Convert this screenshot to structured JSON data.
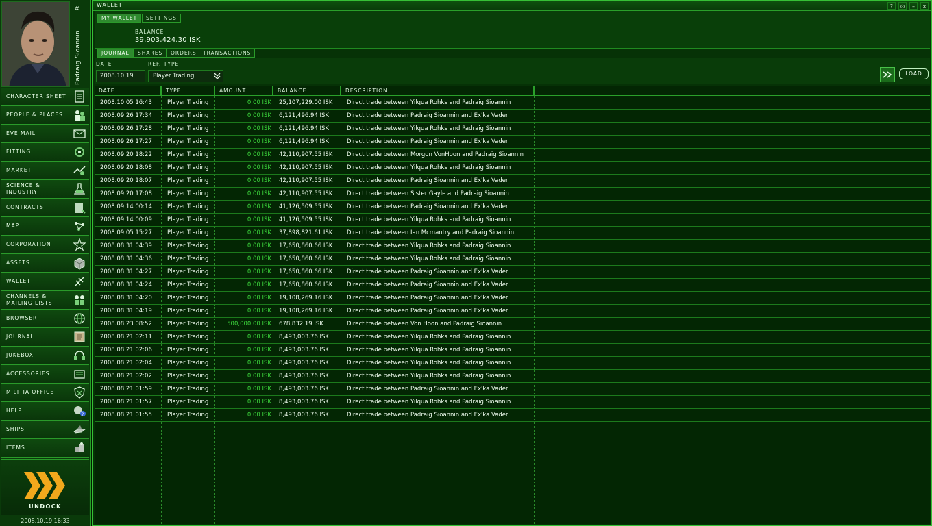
{
  "sidebar": {
    "character_name": "Padraig Sioannin",
    "collapse_glyph": "«",
    "items": [
      {
        "label": "CHARACTER SHEET",
        "icon": "character-sheet-icon"
      },
      {
        "label": "PEOPLE & PLACES",
        "icon": "people-places-icon"
      },
      {
        "label": "EVE MAIL",
        "icon": "mail-icon"
      },
      {
        "label": "FITTING",
        "icon": "fitting-icon"
      },
      {
        "label": "MARKET",
        "icon": "market-icon"
      },
      {
        "label": "SCIENCE & INDUSTRY",
        "icon": "science-icon"
      },
      {
        "label": "CONTRACTS",
        "icon": "contracts-icon"
      },
      {
        "label": "MAP",
        "icon": "map-icon"
      },
      {
        "label": "CORPORATION",
        "icon": "corporation-icon"
      },
      {
        "label": "ASSETS",
        "icon": "assets-icon"
      },
      {
        "label": "WALLET",
        "icon": "wallet-icon"
      },
      {
        "label": "CHANNELS & MAILING LISTS",
        "icon": "channels-icon"
      },
      {
        "label": "BROWSER",
        "icon": "browser-icon"
      },
      {
        "label": "JOURNAL",
        "icon": "journal-icon"
      },
      {
        "label": "JUKEBOX",
        "icon": "jukebox-icon"
      },
      {
        "label": "ACCESSORIES",
        "icon": "accessories-icon"
      },
      {
        "label": "MILITIA OFFICE",
        "icon": "militia-icon"
      },
      {
        "label": "HELP",
        "icon": "help-icon"
      },
      {
        "label": "SHIPS",
        "icon": "ships-icon"
      },
      {
        "label": "ITEMS",
        "icon": "items-icon"
      }
    ],
    "undock_label": "UNDOCK",
    "clock": "2008.10.19  16:33"
  },
  "window": {
    "title": "WALLET",
    "controls": [
      "?",
      "⊙",
      "–",
      "×"
    ],
    "top_tabs": [
      "MY WALLET",
      "SETTINGS"
    ],
    "balance_label": "BALANCE",
    "balance_value": "39,903,424.30 ISK",
    "sub_tabs": [
      "JOURNAL",
      "SHARES",
      "ORDERS",
      "TRANSACTIONS"
    ],
    "filter": {
      "date_label": "DATE",
      "date_value": "2008.10.19",
      "ref_type_label": "REF. TYPE",
      "ref_type_value": "Player Trading",
      "load_label": "LOAD"
    },
    "columns": [
      "DATE",
      "TYPE",
      "AMOUNT",
      "BALANCE",
      "DESCRIPTION"
    ],
    "rows": [
      [
        "2008.10.05 16:43",
        "Player Trading",
        "0.00 ISK",
        "25,107,229.00 ISK",
        "Direct trade between Yilqua Rohks and Padraig Sioannin"
      ],
      [
        "2008.09.26 17:34",
        "Player Trading",
        "0.00 ISK",
        "6,121,496.94 ISK",
        "Direct trade between Padraig Sioannin and Ex'ka Vader"
      ],
      [
        "2008.09.26 17:28",
        "Player Trading",
        "0.00 ISK",
        "6,121,496.94 ISK",
        "Direct trade between Yilqua Rohks and Padraig Sioannin"
      ],
      [
        "2008.09.26 17:27",
        "Player Trading",
        "0.00 ISK",
        "6,121,496.94 ISK",
        "Direct trade between Padraig Sioannin and Ex'ka Vader"
      ],
      [
        "2008.09.20 18:22",
        "Player Trading",
        "0.00 ISK",
        "42,110,907.55 ISK",
        "Direct trade between Morgon VonHoon and Padraig Sioannin"
      ],
      [
        "2008.09.20 18:08",
        "Player Trading",
        "0.00 ISK",
        "42,110,907.55 ISK",
        "Direct trade between Yilqua Rohks and Padraig Sioannin"
      ],
      [
        "2008.09.20 18:07",
        "Player Trading",
        "0.00 ISK",
        "42,110,907.55 ISK",
        "Direct trade between Padraig Sioannin and Ex'ka Vader"
      ],
      [
        "2008.09.20 17:08",
        "Player Trading",
        "0.00 ISK",
        "42,110,907.55 ISK",
        "Direct trade between Sister Gayle and Padraig Sioannin"
      ],
      [
        "2008.09.14 00:14",
        "Player Trading",
        "0.00 ISK",
        "41,126,509.55 ISK",
        "Direct trade between Padraig Sioannin and Ex'ka Vader"
      ],
      [
        "2008.09.14 00:09",
        "Player Trading",
        "0.00 ISK",
        "41,126,509.55 ISK",
        "Direct trade between Yilqua Rohks and Padraig Sioannin"
      ],
      [
        "2008.09.05 15:27",
        "Player Trading",
        "0.00 ISK",
        "37,898,821.61 ISK",
        "Direct trade between Ian Mcmantry and Padraig Sioannin"
      ],
      [
        "2008.08.31 04:39",
        "Player Trading",
        "0.00 ISK",
        "17,650,860.66 ISK",
        "Direct trade between Yilqua Rohks and Padraig Sioannin"
      ],
      [
        "2008.08.31 04:36",
        "Player Trading",
        "0.00 ISK",
        "17,650,860.66 ISK",
        "Direct trade between Yilqua Rohks and Padraig Sioannin"
      ],
      [
        "2008.08.31 04:27",
        "Player Trading",
        "0.00 ISK",
        "17,650,860.66 ISK",
        "Direct trade between Padraig Sioannin and Ex'ka Vader"
      ],
      [
        "2008.08.31 04:24",
        "Player Trading",
        "0.00 ISK",
        "17,650,860.66 ISK",
        "Direct trade between Padraig Sioannin and Ex'ka Vader"
      ],
      [
        "2008.08.31 04:20",
        "Player Trading",
        "0.00 ISK",
        "19,108,269.16 ISK",
        "Direct trade between Padraig Sioannin and Ex'ka Vader"
      ],
      [
        "2008.08.31 04:19",
        "Player Trading",
        "0.00 ISK",
        "19,108,269.16 ISK",
        "Direct trade between Padraig Sioannin and Ex'ka Vader"
      ],
      [
        "2008.08.23 08:52",
        "Player Trading",
        "500,000.00 ISK",
        "678,832.19 ISK",
        "Direct trade between Von Hoon and Padraig Sioannin"
      ],
      [
        "2008.08.21 02:11",
        "Player Trading",
        "0.00 ISK",
        "8,493,003.76 ISK",
        "Direct trade between Yilqua Rohks and Padraig Sioannin"
      ],
      [
        "2008.08.21 02:06",
        "Player Trading",
        "0.00 ISK",
        "8,493,003.76 ISK",
        "Direct trade between Yilqua Rohks and Padraig Sioannin"
      ],
      [
        "2008.08.21 02:04",
        "Player Trading",
        "0.00 ISK",
        "8,493,003.76 ISK",
        "Direct trade between Yilqua Rohks and Padraig Sioannin"
      ],
      [
        "2008.08.21 02:02",
        "Player Trading",
        "0.00 ISK",
        "8,493,003.76 ISK",
        "Direct trade between Yilqua Rohks and Padraig Sioannin"
      ],
      [
        "2008.08.21 01:59",
        "Player Trading",
        "0.00 ISK",
        "8,493,003.76 ISK",
        "Direct trade between Padraig Sioannin and Ex'ka Vader"
      ],
      [
        "2008.08.21 01:57",
        "Player Trading",
        "0.00 ISK",
        "8,493,003.76 ISK",
        "Direct trade between Yilqua Rohks and Padraig Sioannin"
      ],
      [
        "2008.08.21 01:55",
        "Player Trading",
        "0.00 ISK",
        "8,493,003.76 ISK",
        "Direct trade between Padraig Sioannin and Ex'ka Vader"
      ]
    ]
  },
  "colors": {
    "background": "#021a02",
    "panel": "#063206",
    "border": "#36c036",
    "amount_text": "#3cd63c",
    "undock_accent": "#f2a81c"
  }
}
